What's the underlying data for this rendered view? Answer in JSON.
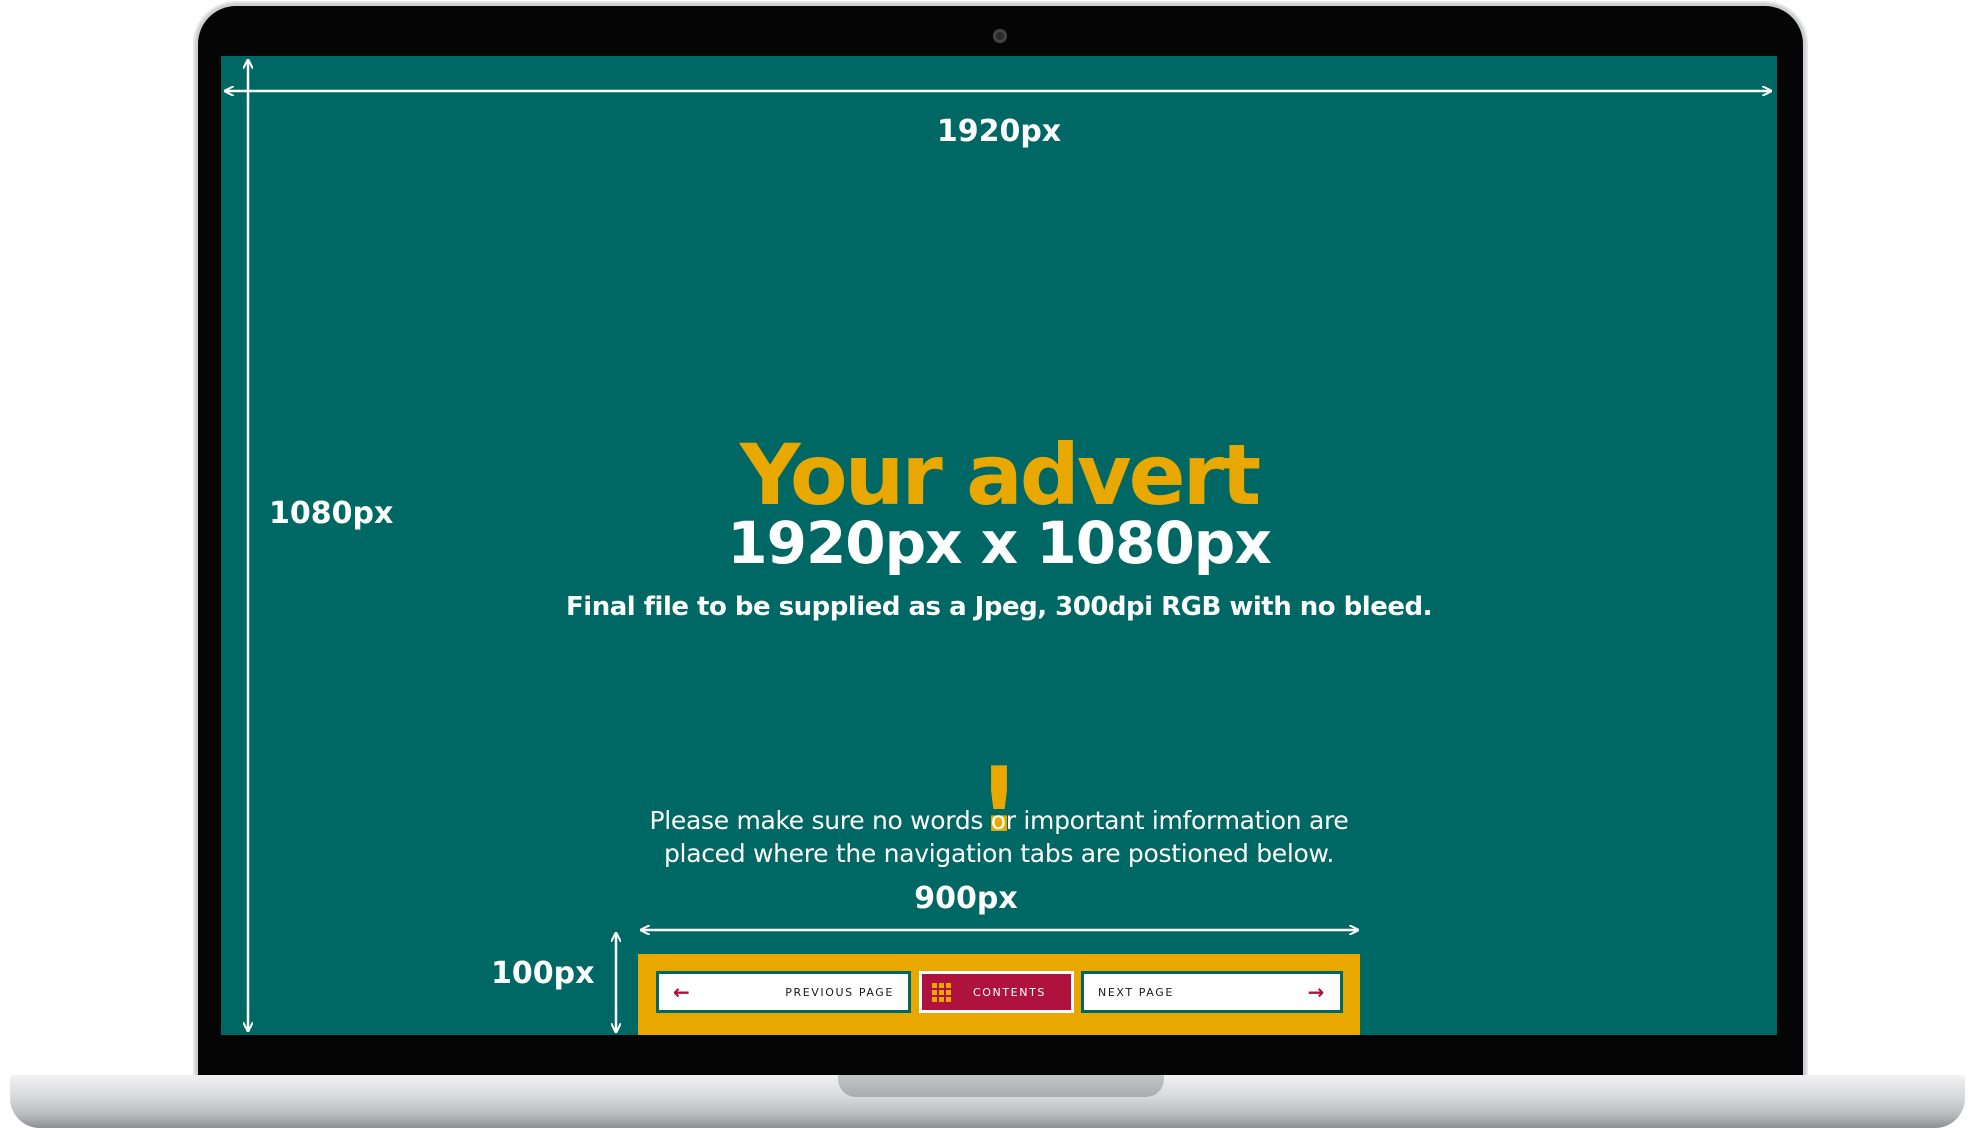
{
  "annotations": {
    "width_label": "1920px",
    "height_label": "1080px",
    "nav_width_label": "900px",
    "nav_height_label": "100px"
  },
  "advert": {
    "headline": "Your advert",
    "size_line": "1920px x 1080px",
    "spec_line": "Final file to be supplied as a Jpeg, 300dpi RGB with no bleed.",
    "warning_icon": "!",
    "warning_line1": "Please make sure no words or important imformation are",
    "warning_line2": "placed where the navigation tabs are postioned below."
  },
  "nav": {
    "prev_label": "PREVIOUS PAGE",
    "contents_label": "CONTENTS",
    "next_label": "NEXT PAGE",
    "prev_icon": "arrow-left-icon",
    "next_icon": "arrow-right-icon",
    "contents_icon": "grid-icon"
  },
  "colors": {
    "screen_background": "#006864",
    "accent_yellow": "#e9a800",
    "contents_red": "#b0123e",
    "text_white": "#ffffff"
  }
}
